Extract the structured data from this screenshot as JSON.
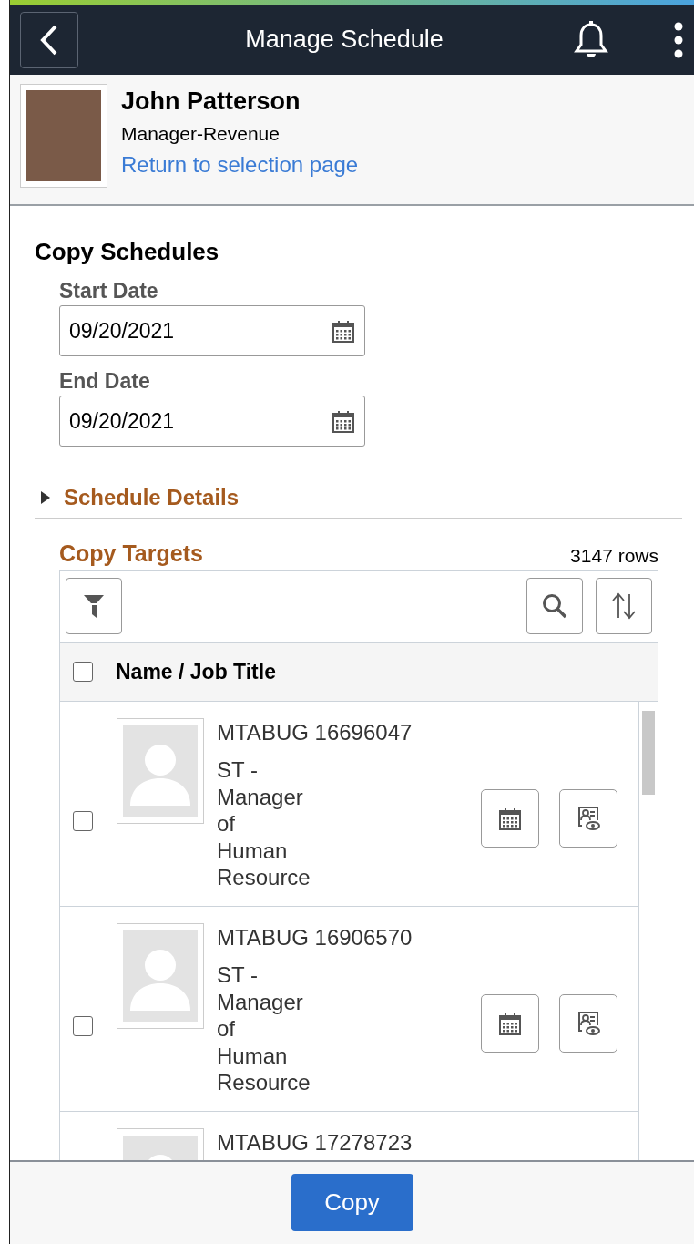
{
  "header": {
    "title": "Manage Schedule"
  },
  "profile": {
    "name": "John Patterson",
    "role": "Manager-Revenue",
    "link": "Return to selection page"
  },
  "section": {
    "title": "Copy Schedules"
  },
  "fields": [
    {
      "label": "Start Date",
      "value": "09/20/2021"
    },
    {
      "label": "End Date",
      "value": "09/20/2021"
    }
  ],
  "collapsible": {
    "label": "Schedule Details",
    "expanded": false
  },
  "grid": {
    "title": "Copy Targets",
    "row_count": "3147 rows",
    "column": "Name / Job Title",
    "all_checked": false,
    "rows": [
      {
        "name": "MTABUG 16696047",
        "title": "ST - Manager of Human Resource",
        "checked": false
      },
      {
        "name": "MTABUG 16906570",
        "title": "ST - Manager of Human Resource",
        "checked": false
      },
      {
        "name": "MTABUG 17278723"
      }
    ]
  },
  "footer": {
    "button": "Copy"
  }
}
